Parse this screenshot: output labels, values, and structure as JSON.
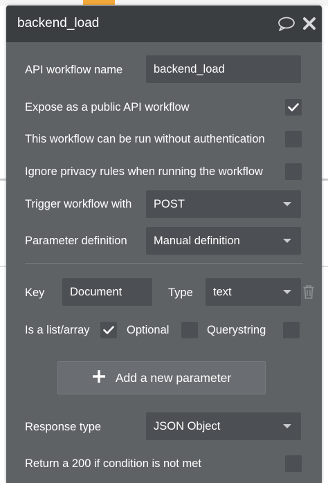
{
  "panel": {
    "title": "backend_load",
    "icons": {
      "chat": "chat-bubble-icon",
      "close": "close-icon"
    }
  },
  "workflow_name": {
    "label": "API workflow name",
    "value": "backend_load"
  },
  "expose_public": {
    "label": "Expose as a public API workflow",
    "checked": true
  },
  "no_auth": {
    "label": "This workflow can be run without authentication",
    "checked": false
  },
  "ignore_privacy": {
    "label": "Ignore privacy rules when running the workflow",
    "checked": false
  },
  "trigger": {
    "label": "Trigger workflow with",
    "value": "POST"
  },
  "param_def": {
    "label": "Parameter definition",
    "value": "Manual definition"
  },
  "parameter": {
    "key_label": "Key",
    "key_value": "Document",
    "type_label": "Type",
    "type_value": "text",
    "list_label": "Is a list/array",
    "list_checked": true,
    "optional_label": "Optional",
    "optional_checked": false,
    "querystring_label": "Querystring",
    "querystring_checked": false
  },
  "add_parameter": {
    "label": "Add a new parameter"
  },
  "response_type": {
    "label": "Response type",
    "value": "JSON Object"
  },
  "return_200": {
    "label": "Return a 200 if condition is not met",
    "checked": false
  },
  "colors": {
    "panel": "#5f6265",
    "header": "#3b3e41",
    "field": "#4c4f53",
    "accent": "#f2a93b"
  }
}
